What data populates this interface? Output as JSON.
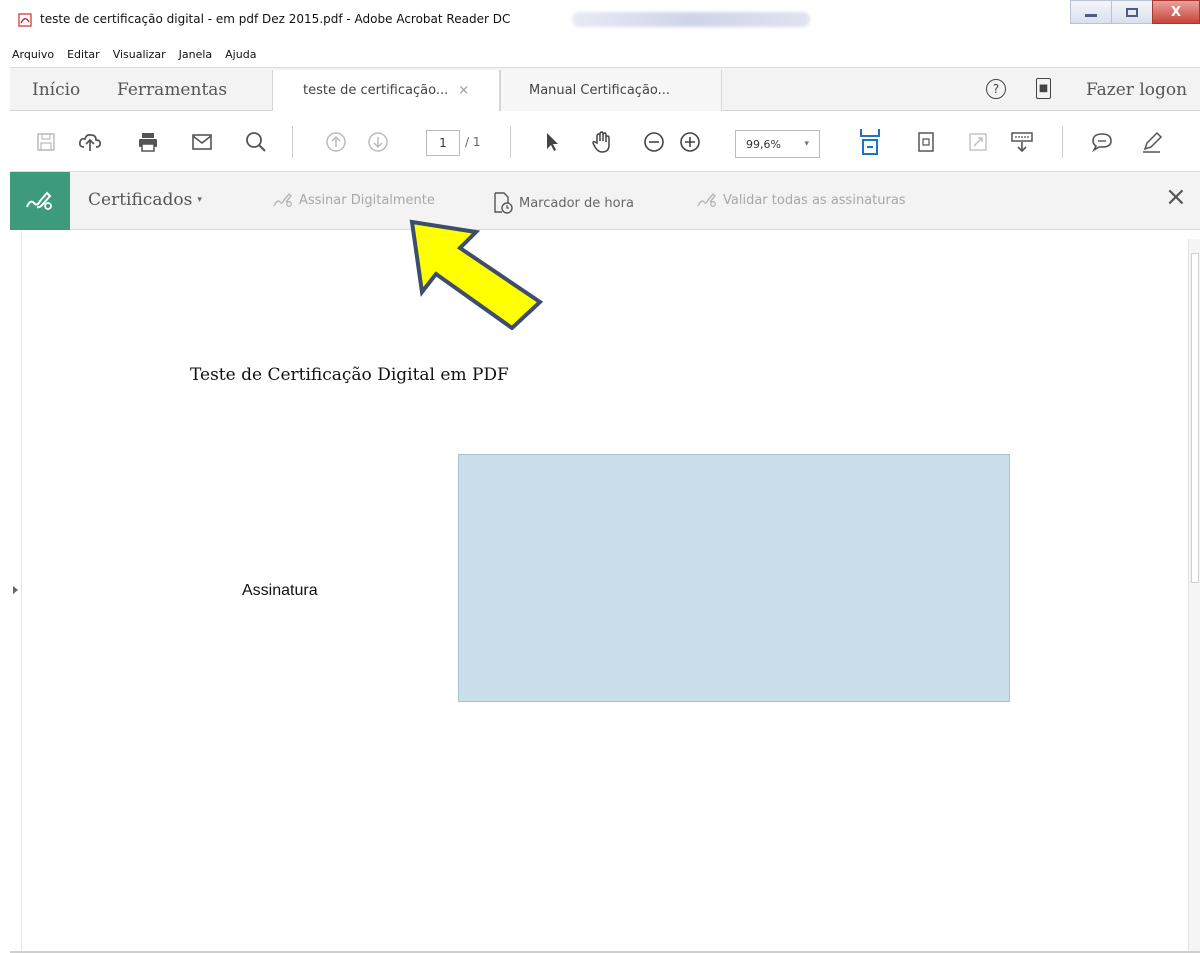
{
  "window": {
    "title": "teste de certificação digital - em pdf Dez 2015.pdf - Adobe Acrobat Reader DC",
    "controls": {
      "minimize": "minimize",
      "maximize": "maximize",
      "close": "X"
    }
  },
  "menu": [
    "Arquivo",
    "Editar",
    "Visualizar",
    "Janela",
    "Ajuda"
  ],
  "tabs_bar": {
    "home": "Início",
    "tools": "Ferramentas",
    "tabs": [
      {
        "label": "teste de certificação...",
        "close": "×",
        "active": true
      },
      {
        "label": "Manual Certificação...",
        "active": false
      }
    ],
    "help_glyph": "?",
    "mobile_glyph": "■",
    "login": "Fazer logon"
  },
  "toolbar": {
    "page_current": "1",
    "page_total": "/ 1",
    "zoom": "99,6%",
    "zoom_caret": "▾",
    "icons": [
      "save-icon",
      "upload-icon",
      "print-icon",
      "email-icon",
      "search-icon",
      "page-up-icon",
      "page-down-icon",
      "select-arrow-icon",
      "hand-icon",
      "zoom-out-icon",
      "zoom-in-icon",
      "fit-page-icon",
      "page-thumbnail-icon",
      "fullscreen-icon",
      "scroll-mode-icon",
      "comment-icon",
      "pen-icon"
    ]
  },
  "certificates": {
    "title": "Certificados",
    "caret": "▾",
    "actions": [
      {
        "label": "Assinar Digitalmente",
        "enabled": false
      },
      {
        "label": "Marcador de hora",
        "enabled": true
      },
      {
        "label": "Validar todas as assinaturas",
        "enabled": false
      }
    ],
    "close": "×"
  },
  "document": {
    "title": "Teste de Certificação Digital em PDF",
    "signature_label": "Assinatura"
  },
  "colors": {
    "accent_green": "#3e9a7c",
    "signature_field": "#cadfe9",
    "annotation_arrow_fill": "#ffff00",
    "annotation_arrow_stroke": "#3c4d6e"
  }
}
